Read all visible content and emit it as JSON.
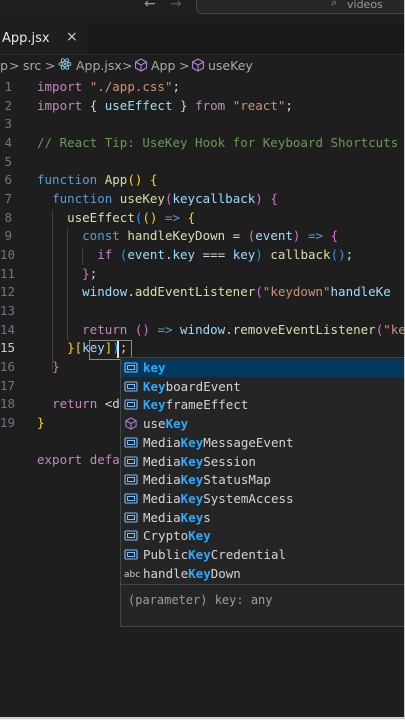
{
  "titlebar": {
    "back_arrow": "←",
    "forward_arrow": "→",
    "command_center_text": "videos",
    "search_icon": "⌕"
  },
  "tab": {
    "label": "App.jsx",
    "close": "×"
  },
  "breadcrumb": {
    "partial_folder": "p",
    "folder": "src",
    "file": "App.jsx",
    "symbol1": "App",
    "symbol2": "useKey",
    "separator": ">"
  },
  "gutter": [
    "1",
    "2",
    "3",
    "4",
    "5",
    "6",
    "7",
    "8",
    "9",
    "10",
    "11",
    "12",
    "13",
    "14",
    "15",
    "16",
    "17",
    "18",
    "19"
  ],
  "active_line": "15",
  "suggestions": {
    "items": [
      {
        "icon": "variable-icon",
        "pre": "",
        "match": "key",
        "post": ""
      },
      {
        "icon": "variable-icon",
        "pre": "",
        "match": "Key",
        "post": "boardEvent"
      },
      {
        "icon": "variable-icon",
        "pre": "",
        "match": "Key",
        "post": "frameEffect"
      },
      {
        "icon": "function-cube-icon",
        "pre": "use",
        "match": "Key",
        "post": ""
      },
      {
        "icon": "variable-icon",
        "pre": "Media",
        "match": "Key",
        "post": "MessageEvent"
      },
      {
        "icon": "variable-icon",
        "pre": "Media",
        "match": "Key",
        "post": "Session"
      },
      {
        "icon": "variable-icon",
        "pre": "Media",
        "match": "Key",
        "post": "StatusMap"
      },
      {
        "icon": "variable-icon",
        "pre": "Media",
        "match": "Key",
        "post": "SystemAccess"
      },
      {
        "icon": "variable-icon",
        "pre": "Media",
        "match": "Key",
        "post": "s"
      },
      {
        "icon": "variable-icon",
        "pre": "Crypto",
        "match": "Key",
        "post": ""
      },
      {
        "icon": "variable-icon",
        "pre": "Public",
        "match": "Key",
        "post": "Credential"
      },
      {
        "icon": "text-abc-icon",
        "pre": "handle",
        "match": "Key",
        "post": "Down"
      }
    ],
    "detail": "(parameter) key: any"
  },
  "colors": {
    "editor_bg": "#1e1e1e",
    "match_highlight": "#2aaaff",
    "selected_row": "#04395e"
  }
}
